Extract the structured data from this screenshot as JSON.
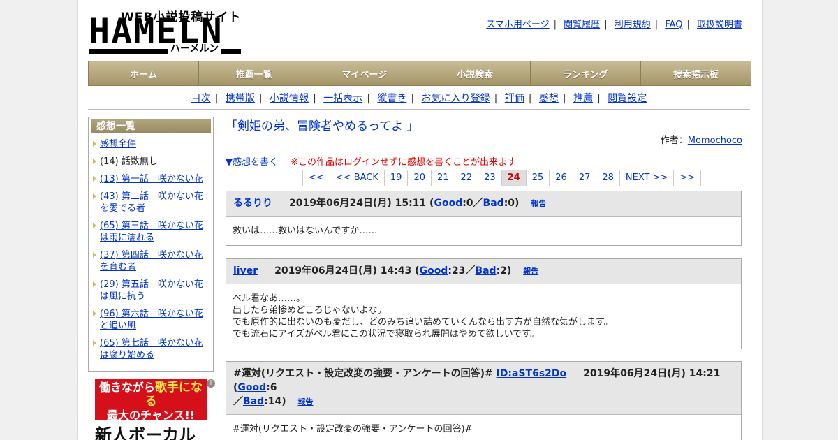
{
  "logo": {
    "top": "WEB小説投稿サイト",
    "main": "HAMELN",
    "kana": "ハーメルン"
  },
  "top_links": [
    "スマホ用ページ",
    "閲覧履歴",
    "利用規約",
    "FAQ",
    "取扱説明書"
  ],
  "global_nav": [
    "ホーム",
    "推薦一覧",
    "マイページ",
    "小説検索",
    "ランキング",
    "捜索掲示板"
  ],
  "sub_nav": [
    "目次",
    "携帯版",
    "小説情報",
    "一括表示",
    "縦書き",
    "お気に入り登録",
    "評価",
    "感想",
    "推薦",
    "閲覧設定"
  ],
  "sidebar": {
    "heading": "感想一覧",
    "items": [
      {
        "label": "感想全件",
        "link": true
      },
      {
        "label": "(14) 話数無し",
        "link": false
      },
      {
        "label": "(13) 第一話　咲かない花",
        "link": true
      },
      {
        "label": "(43) 第二話　咲かない花を愛でる者",
        "link": true
      },
      {
        "label": "(65) 第三話　咲かない花は雨に濡れる",
        "link": true
      },
      {
        "label": "(37) 第四話　咲かない花を育む者",
        "link": true
      },
      {
        "label": "(29) 第五話　咲かない花は風に抗う",
        "link": true
      },
      {
        "label": "(96) 第六話　咲かない花と追い風",
        "link": true
      },
      {
        "label": "(65) 第七話　咲かない花は腐り始める",
        "link": true
      }
    ]
  },
  "ad": {
    "line1": "働きながら",
    "line1b": "歌手になる",
    "line2": "最大のチャンス!!",
    "line3": "新人ボーカル",
    "info": "i"
  },
  "novel": {
    "title": "「剣姫の弟、冒険者やめるってよ 」",
    "author_label": "作者：",
    "author": "Momochoco",
    "write_link": "▼感想を書く",
    "notice": "※この作品はログインせずに感想を書くことが出来ます"
  },
  "pager": [
    "<<",
    "<< BACK",
    "19",
    "20",
    "21",
    "22",
    "23",
    "24",
    "25",
    "26",
    "27",
    "28",
    "NEXT >>",
    ">>"
  ],
  "pager_current": "24",
  "reviews": [
    {
      "name": "るるりり",
      "date": "2019年06月24日(月) 15:11",
      "good_label": "Good",
      "good": ":0／",
      "bad_label": "Bad",
      "bad": ":0)",
      "report": "報告",
      "lines": [
        "救いは……救いはないんですか……"
      ]
    },
    {
      "name": "liver",
      "date": "2019年06月24日(月) 14:43",
      "good_label": "Good",
      "good": ":23／",
      "bad_label": "Bad",
      "bad": ":2)",
      "report": "報告",
      "lines": [
        "ベル君なあ……。",
        "出したら弟惨めどころじゃないよな。",
        "でも原作的に出ないのも変だし、どのみち追い詰めていくんなら出す方が自然な気がします。",
        "でも流石にアイズがベル君にこの状況で寝取られ展開はやめて欲しいです。"
      ]
    },
    {
      "prefix": "#運対(リクエスト・設定改変の強要・アンケートの回答)#",
      "name": "ID:aST6s2Do",
      "date": "2019年06月24日(月) 14:21",
      "good_label": "Good",
      "good": ":6",
      "bad_pre": "／",
      "bad_label": "Bad",
      "bad": ":14)",
      "report": "報告",
      "lines": [
        "#運対(リクエスト・設定改変の強要・アンケートの回答)#"
      ]
    }
  ]
}
